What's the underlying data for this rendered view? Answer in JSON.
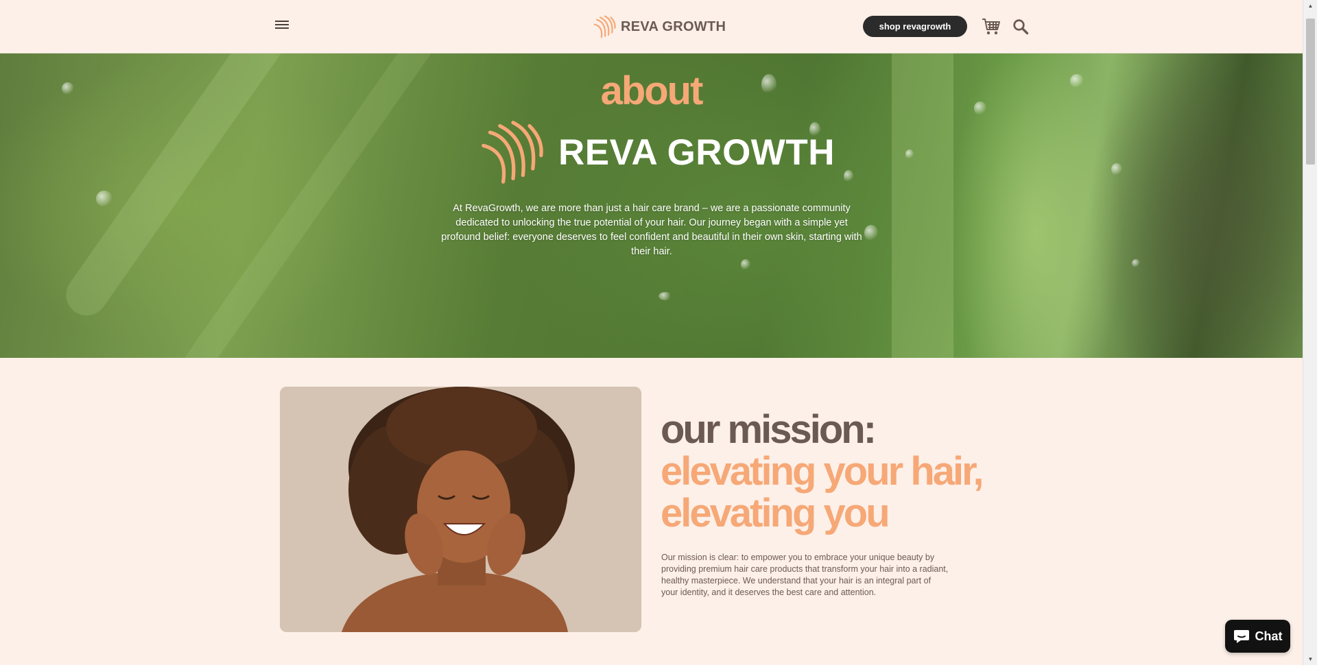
{
  "header": {
    "menu_icon": "hamburger-menu-icon",
    "logo_text": "REVA GROWTH",
    "shop_button": "shop revagrowth",
    "cart_icon": "shopping-cart-icon",
    "search_icon": "search-icon"
  },
  "hero": {
    "title": "about",
    "logo_text": "REVA GROWTH",
    "description": "At RevaGrowth, we are more than just a hair care brand – we are a passionate community dedicated to unlocking the true potential of your hair. Our journey began with a simple yet profound belief: everyone deserves to feel confident and beautiful in their own skin, starting with their hair."
  },
  "mission": {
    "heading_line1": "our mission:",
    "heading_line2": "elevating your hair,",
    "heading_line3": "elevating you",
    "description": "Our mission is clear: to empower you to embrace your unique beauty by providing premium hair care products that transform your hair into a radiant, healthy masterpiece. We understand that your hair is an integral part of your identity, and it deserves the best care and attention."
  },
  "chat": {
    "label": "Chat"
  },
  "colors": {
    "accent": "#f6a877",
    "text_brown": "#6b5a54",
    "background": "#fdf0e8",
    "button_dark": "#2b2b2b"
  }
}
